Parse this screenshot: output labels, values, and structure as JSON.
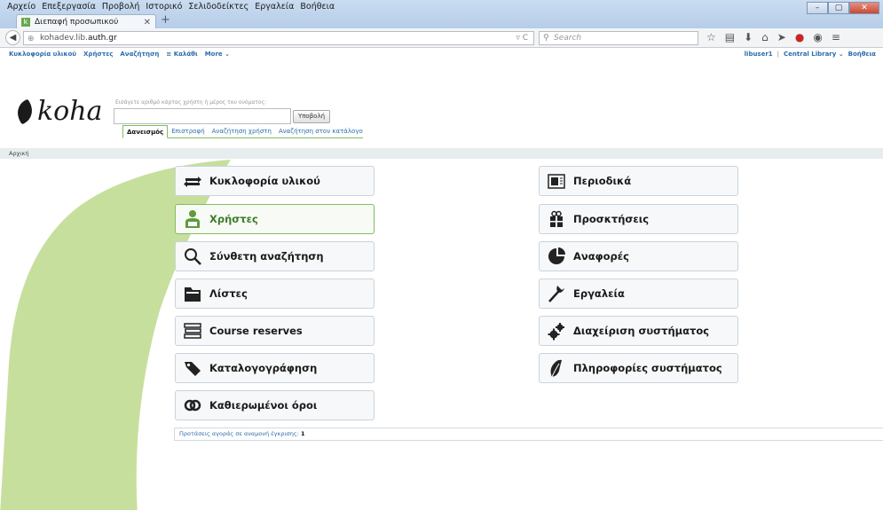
{
  "browser": {
    "menu": [
      "Αρχείο",
      "Επεξεργασία",
      "Προβολή",
      "Ιστορικό",
      "Σελιδοδείκτες",
      "Εργαλεία",
      "Βοήθεια"
    ],
    "tab_title": "Διεπαφή προσωπικού",
    "url_prefix": "kohadev.lib.",
    "url_domain": "auth.gr",
    "search_placeholder": "Search",
    "window_controls": [
      "–",
      "▢",
      "✕"
    ]
  },
  "koha_nav": {
    "left": [
      "Κυκλοφορία υλικού",
      "Χρήστες",
      "Αναζήτηση",
      "≡ Καλάθι",
      "More ⌄"
    ],
    "user": "libuser1",
    "branch": "Central Library ⌄",
    "help": "Βοήθεια"
  },
  "logo_text": "koha",
  "search": {
    "hint": "Εισάγετε αριθμό κάρτας χρήστη ή μέρος του ονόματος:",
    "submit_label": "Υποβολή",
    "tabs": [
      "Δανεισμός",
      "Επιστροφή",
      "Αναζήτηση χρήστη",
      "Αναζήτηση στον κατάλογο"
    ]
  },
  "breadcrumb": "Αρχική",
  "modules_left": [
    {
      "label": "Κυκλοφορία υλικού",
      "icon": "circulation-icon"
    },
    {
      "label": "Χρήστες",
      "icon": "patrons-icon"
    },
    {
      "label": "Σύνθετη αναζήτηση",
      "icon": "search-icon"
    },
    {
      "label": "Λίστες",
      "icon": "lists-icon"
    },
    {
      "label": "Course reserves",
      "icon": "course-reserves-icon"
    },
    {
      "label": "Καταλογογράφηση",
      "icon": "cataloging-icon"
    },
    {
      "label": "Καθιερωμένοι όροι",
      "icon": "authorities-icon"
    }
  ],
  "modules_right": [
    {
      "label": "Περιοδικά",
      "icon": "serials-icon"
    },
    {
      "label": "Προσκτήσεις",
      "icon": "acquisitions-icon"
    },
    {
      "label": "Αναφορές",
      "icon": "reports-icon"
    },
    {
      "label": "Εργαλεία",
      "icon": "tools-icon"
    },
    {
      "label": "Διαχείριση συστήματος",
      "icon": "admin-icon"
    },
    {
      "label": "Πληροφορίες συστήματος",
      "icon": "about-icon"
    }
  ],
  "footer": {
    "text": "Προτάσεις αγοράς σε αναμονή έγκρισης:",
    "count": "1"
  },
  "colors": {
    "accent_green": "#7fbf5e",
    "link_blue": "#2d6dac",
    "bg_shape": "#c7df9c"
  }
}
